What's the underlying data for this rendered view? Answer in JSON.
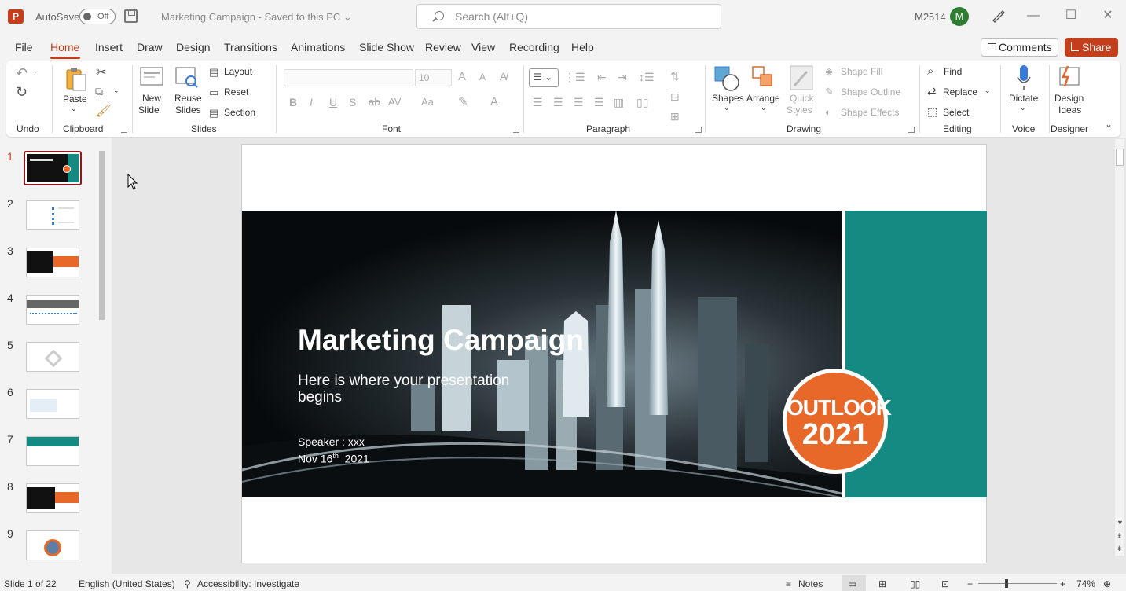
{
  "titlebar": {
    "app_logo": "P",
    "autosave_label": "AutoSave",
    "autosave_state": "Off",
    "document_title": "Marketing Campaign  -  Saved to this PC  ⌄",
    "search_placeholder": "Search (Alt+Q)",
    "user_code": "M2514",
    "avatar_initial": "M"
  },
  "menu": {
    "items": [
      "File",
      "Home",
      "Insert",
      "Draw",
      "Design",
      "Transitions",
      "Animations",
      "Slide Show",
      "Review",
      "View",
      "Recording",
      "Help"
    ],
    "active": "Home",
    "comments_label": "Comments",
    "share_label": "Share"
  },
  "ribbon": {
    "undo": {
      "label": "Undo"
    },
    "clipboard": {
      "label": "Clipboard",
      "paste": "Paste"
    },
    "slides": {
      "label": "Slides",
      "new_slide_1": "New",
      "new_slide_2": "Slide",
      "reuse_1": "Reuse",
      "reuse_2": "Slides",
      "layout": "Layout",
      "reset": "Reset",
      "section": "Section"
    },
    "font": {
      "label": "Font",
      "font_size": "10",
      "grow": "A",
      "shrink": "A"
    },
    "paragraph": {
      "label": "Paragraph"
    },
    "drawing": {
      "label": "Drawing",
      "shapes": "Shapes",
      "arrange": "Arrange",
      "quick_1": "Quick",
      "quick_2": "Styles",
      "shape_fill": "Shape Fill",
      "shape_outline": "Shape Outline",
      "shape_effects": "Shape Effects"
    },
    "editing": {
      "label": "Editing",
      "find": "Find",
      "replace": "Replace",
      "select": "Select"
    },
    "voice": {
      "label": "Voice",
      "dictate": "Dictate"
    },
    "designer": {
      "label": "Designer",
      "design_1": "Design",
      "design_2": "Ideas"
    }
  },
  "thumbnails": [
    "1",
    "2",
    "3",
    "4",
    "5",
    "6",
    "7",
    "8",
    "9"
  ],
  "slide": {
    "title": "Marketing Campaign",
    "subtitle": "Here is where your presentation begins",
    "speaker": "Speaker : xxx",
    "date_main": "Nov 16",
    "date_sup": "th",
    "date_year": "  2021",
    "badge_line1": "OUTLOOK",
    "badge_line2": "2021"
  },
  "colors": {
    "accent": "#c43e1c",
    "teal": "#148a82",
    "orange": "#e8682a"
  },
  "status": {
    "slide_count": "Slide 1 of 22",
    "language": "English (United States)",
    "accessibility": "Accessibility: Investigate",
    "notes": "Notes",
    "zoom": "74%"
  }
}
